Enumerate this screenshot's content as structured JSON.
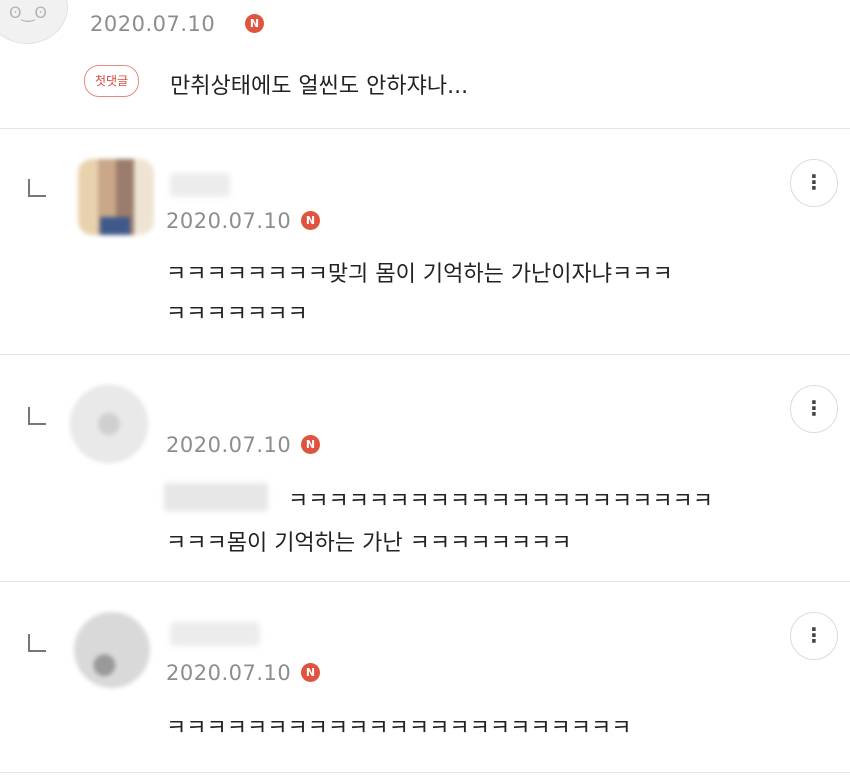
{
  "top_comment": {
    "avatar_icon": "ʘ‿ʘ",
    "date": "2020.07.10",
    "new_badge": "N",
    "first_comment_badge": "첫댓글",
    "text": "만취상태에도 얼씬도 안하쟈나..."
  },
  "replies": [
    {
      "date": "2020.07.10",
      "new_badge": "N",
      "line1": "ㅋㅋㅋㅋㅋㅋㅋㅋ맞긔 몸이 기억하는 가난이자냐ㅋㅋㅋ",
      "line2": "ㅋㅋㅋㅋㅋㅋㅋ",
      "more_icon": "⋮"
    },
    {
      "date": "2020.07.10",
      "new_badge": "N",
      "line1": "ㅋㅋㅋㅋㅋㅋㅋㅋㅋㅋㅋㅋㅋㅋㅋㅋㅋㅋㅋㅋㅋ",
      "line2": "ㅋㅋㅋ몸이 기억하는 가난 ㅋㅋㅋㅋㅋㅋㅋㅋ",
      "more_icon": "⋮"
    },
    {
      "date": "2020.07.10",
      "new_badge": "N",
      "line1": "ㅋㅋㅋㅋㅋㅋㅋㅋㅋㅋㅋㅋㅋㅋㅋㅋㅋㅋㅋㅋㅋㅋㅋ",
      "more_icon": "⋮"
    }
  ],
  "colors": {
    "date_gray": "#8d8d8d",
    "badge_red": "#e0533f",
    "divider": "#e4e4e4"
  }
}
